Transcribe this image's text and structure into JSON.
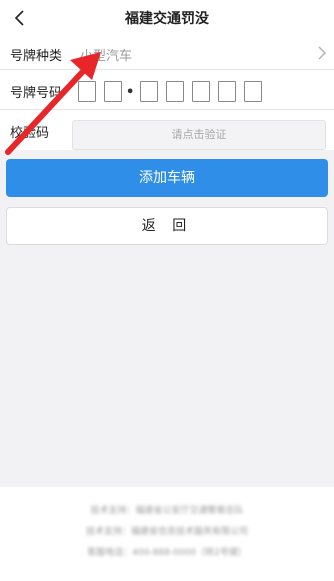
{
  "header": {
    "title": "福建交通罚没",
    "back_icon": "chevron-left-icon"
  },
  "form": {
    "plate_type": {
      "label": "号牌种类",
      "value": "小型汽车",
      "icon": "chevron-right-icon"
    },
    "plate_number": {
      "label": "号牌号码",
      "separator": "•"
    },
    "verify": {
      "label": "校验码",
      "button_label": "请点击验证"
    }
  },
  "actions": {
    "add_label": "添加车辆",
    "return_label": "返 回"
  },
  "footer": {
    "lines": [
      "技术支持：福建省公安厅交通警察总队",
      "技术支持：福建省信息技术服务有限公司",
      "客服电话：400-888-0000（转2号键）"
    ]
  },
  "colors": {
    "primary": "#2f8fe8",
    "arrow": "#e8262a",
    "background": "#f2f2f4"
  }
}
